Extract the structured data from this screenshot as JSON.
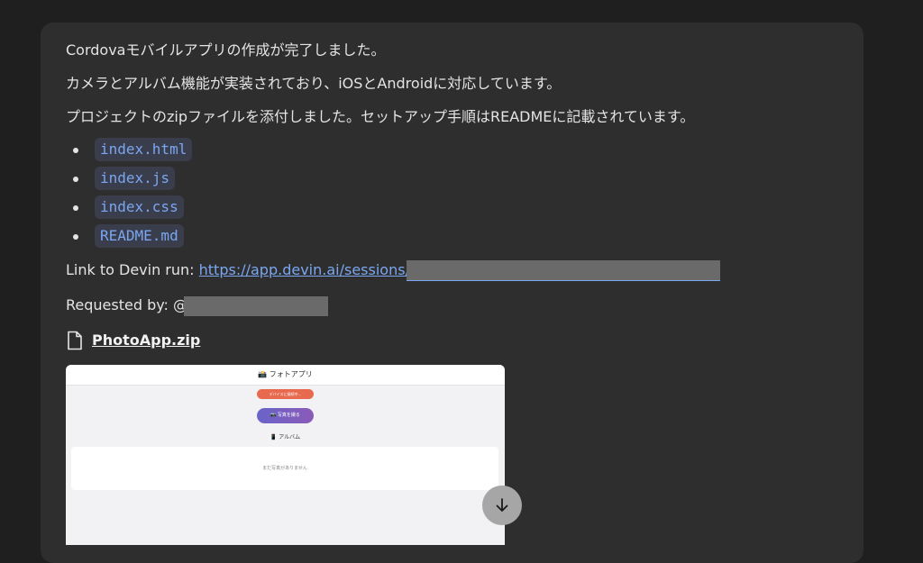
{
  "message": {
    "line1": "Cordovaモバイルアプリの作成が完了しました。",
    "line2": "カメラとアルバム機能が実装されており、iOSとAndroidに対応しています。",
    "line3": "プロジェクトのzipファイルを添付しました。セットアップ手順はREADMEに記載されています。",
    "files": [
      "index.html",
      "index.js",
      "index.css",
      "README.md"
    ],
    "link_label": "Link to Devin run: ",
    "link_url_visible": "https://app.devin.ai/sessions/",
    "requested_label": "Requested by: @",
    "attachment_name": "PhotoApp.zip"
  },
  "preview": {
    "header_title": "📸 フォトアプリ",
    "status_pill": "デバイスに接続中...",
    "take_photo_button": "📷 写真を撮る",
    "album_title": "📱 アルバム",
    "empty_album": "まだ写真がありません"
  },
  "colors": {
    "background": "#1f1f1f",
    "bubble": "#2e2e2e",
    "link": "#7aa7f0",
    "code_bg": "#3a3d4b"
  },
  "icons": {
    "attachment": "file-icon",
    "scroll": "arrow-down-icon"
  }
}
